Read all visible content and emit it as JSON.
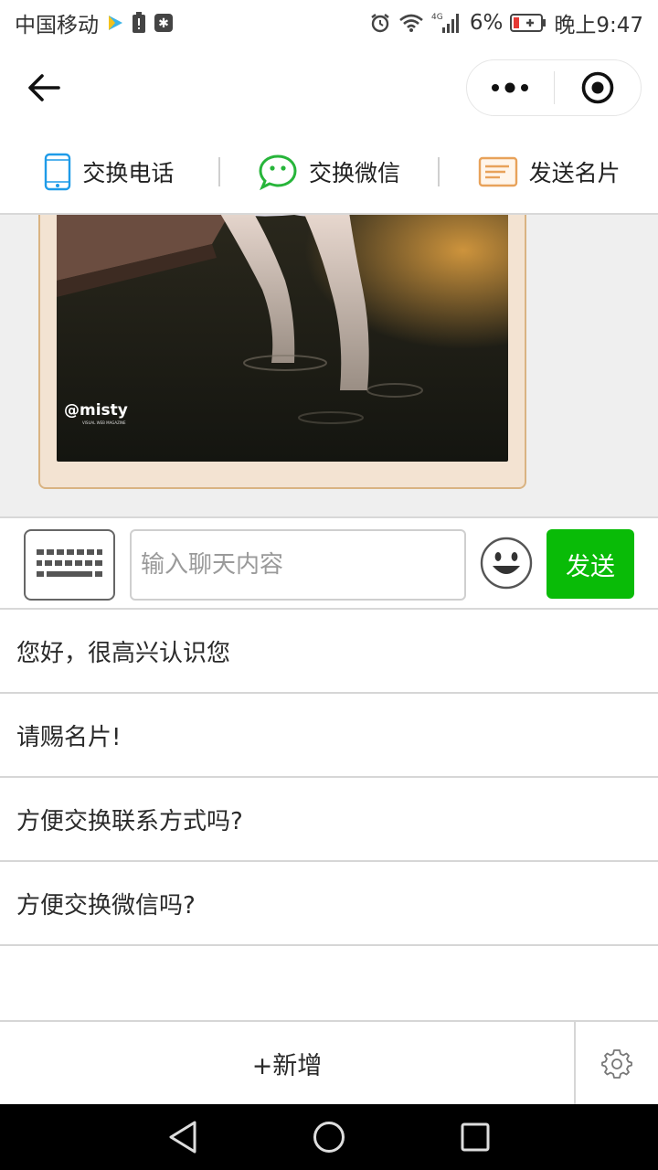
{
  "status_bar": {
    "carrier": "中国移动",
    "network": "4G",
    "battery_percent": "6%",
    "time": "晚上9:47"
  },
  "nav": {
    "icons": [
      "back-arrow-icon",
      "more-dots-icon",
      "target-close-icon"
    ]
  },
  "actions": [
    {
      "label": "交换电话",
      "icon": "phone-icon",
      "color": "#1e9be8"
    },
    {
      "label": "交换微信",
      "icon": "wechat-icon",
      "color": "#27b53a"
    },
    {
      "label": "发送名片",
      "icon": "card-icon",
      "color": "#e8a25a"
    }
  ],
  "chat": {
    "photo_watermark": "@misty",
    "photo_subtext": "VISUAL WEB MAGAZINE"
  },
  "input_bar": {
    "placeholder": "输入聊天内容",
    "value": "",
    "send_label": "发送",
    "send_color": "#09bb07"
  },
  "quick_replies": [
    "您好，很高兴认识您",
    "请赐名片!",
    "方便交换联系方式吗?",
    "方便交换微信吗?"
  ],
  "bottom": {
    "add_label": "+新增"
  }
}
